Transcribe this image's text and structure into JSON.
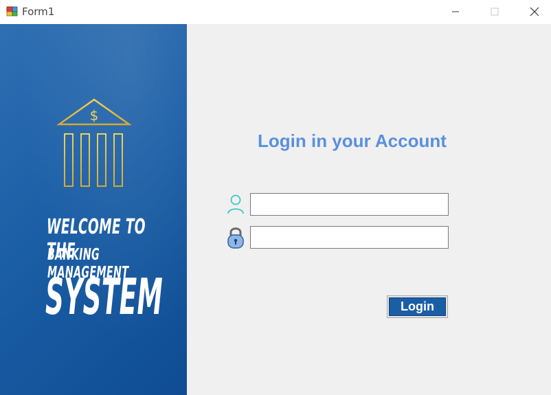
{
  "window": {
    "title": "Form1",
    "minimize": "minimize",
    "maximize": "maximize",
    "close": "close"
  },
  "banner": {
    "line1": "WELCOME TO THE",
    "line2": "BANKING MANAGEMENT",
    "line3": "SYSTEM",
    "logo_icon": "bank-building-dollar-icon"
  },
  "login": {
    "heading": "Login in your Account",
    "username_icon": "user-icon",
    "password_icon": "padlock-icon",
    "username_value": "",
    "password_value": "",
    "button_label": "Login"
  },
  "colors": {
    "banner_blue": "#1a5ea6",
    "heading_blue": "#5a8fde",
    "button_blue": "#1a5fa5",
    "logo_gold": "#e8c34a"
  }
}
